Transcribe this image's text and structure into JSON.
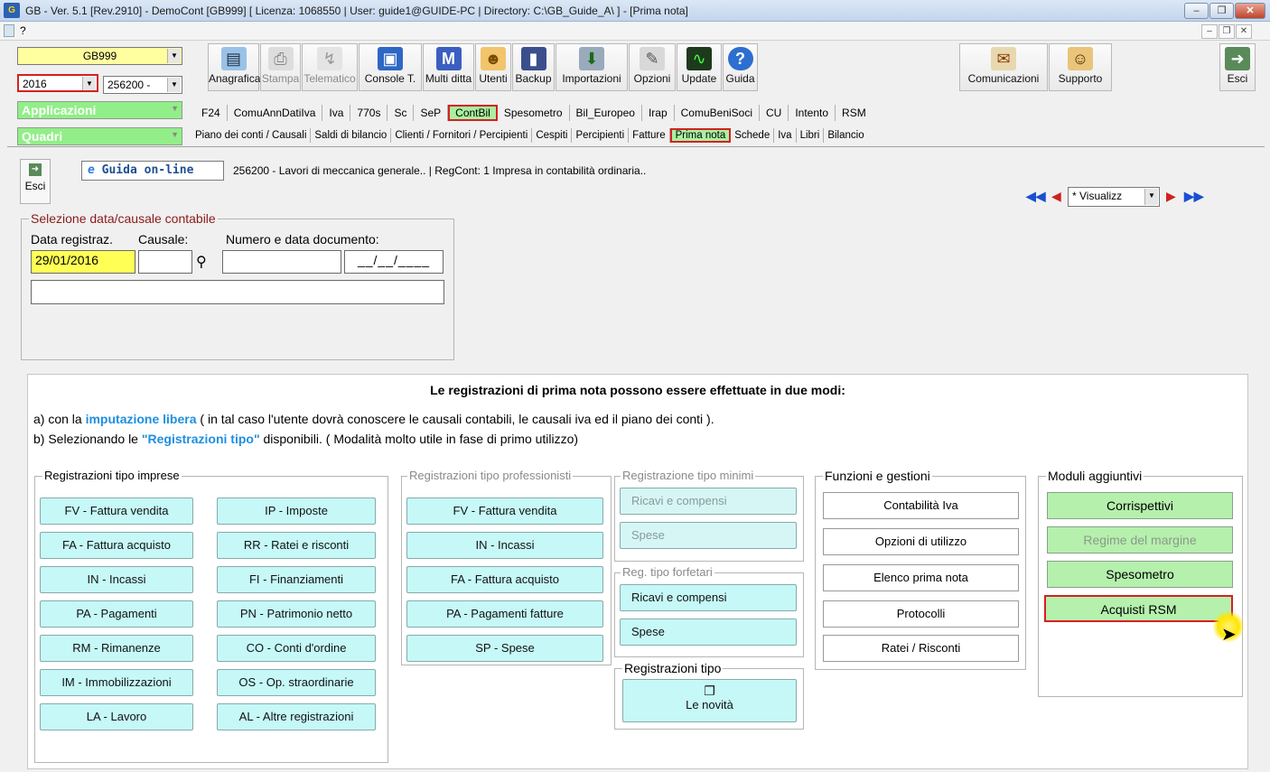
{
  "window": {
    "app_icon": "G",
    "title": "GB - Ver. 5.1 [Rev.2910] - DemoCont [GB999]     [ Licenza: 1068550 | User: guide1@GUIDE-PC | Directory: C:\\GB_Guide_A\\ ] - [Prima nota]",
    "min": "–",
    "max": "❐",
    "close": "✕"
  },
  "mdi": {
    "help": "?",
    "min": "–",
    "restore": "❐",
    "close": "✕"
  },
  "toolbar": {
    "company": "GB999",
    "year": "2016",
    "code": "256200 -",
    "applicazioni": "Applicazioni",
    "quadri": "Quadri",
    "buttons": [
      {
        "label": "Anagrafica",
        "icon": "address-book-icon"
      },
      {
        "label": "Stampa",
        "icon": "printer-icon"
      },
      {
        "label": "Telematico",
        "icon": "telematic-icon"
      },
      {
        "label": "Console T.",
        "icon": "console-icon"
      },
      {
        "label": "Multi ditta",
        "icon": "multi-company-icon",
        "glyph": "M"
      },
      {
        "label": "Utenti",
        "icon": "users-icon"
      },
      {
        "label": "Backup",
        "icon": "backup-icon"
      },
      {
        "label": "Importazioni",
        "icon": "import-icon"
      },
      {
        "label": "Opzioni",
        "icon": "wrench-icon"
      },
      {
        "label": "Update",
        "icon": "update-icon"
      },
      {
        "label": "Guida",
        "icon": "help-icon",
        "glyph": "?"
      },
      {
        "label": "Comunicazioni",
        "icon": "communications-icon"
      },
      {
        "label": "Supporto",
        "icon": "support-icon"
      },
      {
        "label": "Esci",
        "icon": "exit-icon"
      }
    ],
    "apps": [
      "F24",
      "ComuAnnDatiIva",
      "Iva",
      "770s",
      "Sc",
      "SeP",
      "ContBil",
      "Spesometro",
      "Bil_Europeo",
      "Irap",
      "ComuBeniSoci",
      "CU",
      "Intento",
      "RSM"
    ],
    "quadri_items": [
      "Piano dei conti / Causali",
      "Saldi di bilancio",
      "Clienti / Fornitori / Percipienti",
      "Cespiti",
      "Percipienti",
      "Fatture",
      "Prima nota",
      "Schede",
      "Iva",
      "Libri",
      "Bilancio"
    ]
  },
  "header": {
    "exit": "Esci",
    "guide": "Guida on-line",
    "guide_icon": "e",
    "info": "256200 - Lavori di meccanica generale.. | RegCont: 1 Impresa  in contabilità ordinaria..",
    "nav_select": "* Visualizz"
  },
  "selection": {
    "legend": "Selezione data/causale contabile",
    "date_label": "Data registraz.",
    "causale_label": "Causale:",
    "doc_label": "Numero e data documento:",
    "date_value": "29/01/2016",
    "doc_date": "__/__/____"
  },
  "info": {
    "title": "Le registrazioni di prima nota possono essere effettuate in due modi:",
    "line_a_pre": "a) con la ",
    "line_a_link": "imputazione libera",
    "line_a_post": " ( in tal caso l'utente dovrà conoscere le causali contabili, le causali iva ed il piano dei conti ).",
    "line_b_pre": "b) Selezionando le ",
    "line_b_link": "\"Registrazioni tipo\"",
    "line_b_post": " disponibili. ( Modalità molto utile in fase di primo utilizzo)"
  },
  "groups": {
    "imprese": {
      "legend": "Registrazioni tipo imprese",
      "col1": [
        "FV - Fattura vendita",
        "FA - Fattura acquisto",
        "IN - Incassi",
        "PA - Pagamenti",
        "RM - Rimanenze",
        "IM - Immobilizzazioni",
        "LA - Lavoro"
      ],
      "col2": [
        "IP - Imposte",
        "RR - Ratei e risconti",
        "FI - Finanziamenti",
        "PN - Patrimonio netto",
        "CO - Conti d'ordine",
        "OS - Op. straordinarie",
        "AL - Altre registrazioni"
      ]
    },
    "professionisti": {
      "legend": "Registrazioni tipo professionisti",
      "items": [
        "FV - Fattura vendita",
        "IN - Incassi",
        "FA - Fattura acquisto",
        "PA - Pagamenti fatture",
        "SP - Spese"
      ]
    },
    "minimi": {
      "legend": "Registrazione tipo minimi",
      "items": [
        "Ricavi e compensi",
        "Spese"
      ]
    },
    "forfetari": {
      "legend": "Reg. tipo forfetari",
      "items": [
        "Ricavi e compensi",
        "Spese"
      ]
    },
    "tipo": {
      "legend": "Registrazioni tipo",
      "button": "Le novità"
    },
    "funzioni": {
      "legend": "Funzioni e gestioni",
      "items": [
        "Contabilità Iva",
        "Opzioni di utilizzo",
        "Elenco prima nota",
        "Protocolli",
        "Ratei / Risconti"
      ]
    },
    "moduli": {
      "legend": "Moduli aggiuntivi",
      "items": [
        "Corrispettivi",
        "Regime del margine",
        "Spesometro",
        "Acquisti RSM"
      ]
    }
  }
}
